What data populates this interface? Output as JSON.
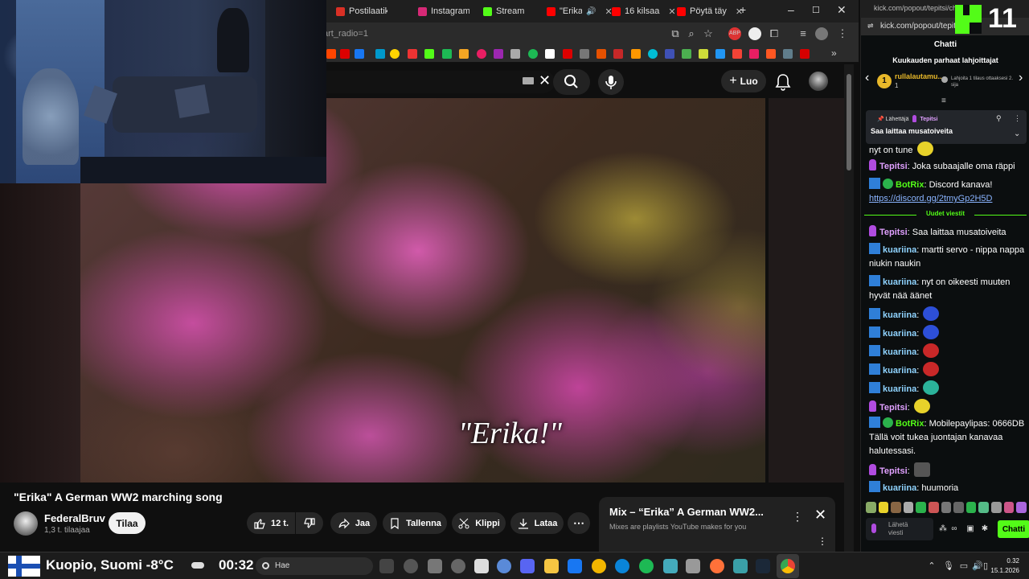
{
  "browser": {
    "tabs": [
      {
        "label": "Postilaatikko",
        "color": "#d93025"
      },
      {
        "label": "Instagram",
        "color": "#d62976"
      },
      {
        "label": "Stream",
        "color": "#53fc18"
      },
      {
        "label": "\"Erika\"",
        "color": "#ff0000"
      },
      {
        "label": "16 kilsaa",
        "color": "#ff0000"
      },
      {
        "label": "Pöytä täy",
        "color": "#ff0000"
      }
    ],
    "address_fragment": "art_radio=1"
  },
  "youtube": {
    "create_label": "Luo",
    "video_overlay_text": "\"Erika!\"",
    "video_title": "\"Erika\" A German WW2 marching song",
    "channel_name": "FederalBruv",
    "channel_subs": "1,3 t. tilaajaa",
    "subscribe_label": "Tilaa",
    "like_count": "12 t.",
    "share_label": "Jaa",
    "save_label": "Tallenna",
    "clip_label": "Klippi",
    "download_label": "Lataa",
    "mix_title": "Mix – “Erika” A German WW2...",
    "mix_subtitle": "Mixes are playlists YouTube makes for you"
  },
  "chat": {
    "url_full": "kick.com/popout/tepitsi/ch...",
    "url_short": "kick.com/popout/tepit",
    "viewer_count": "11",
    "title": "Chatti",
    "gifters_title": "Kuukauden parhaat lahjoittajat",
    "top_gifter_rank": "1",
    "top_gifter_name": "rullalautamu...",
    "top_gifter_count": "1",
    "gift_prompt": "Lahjoita 1 tilaus ottaaksesi 2. sija",
    "pinned_sender_label": "Lähettäjä",
    "pinned_sender": "Tepitsi",
    "pinned_text": "Saa laittaa musatoiveita",
    "new_messages_label": "Uudet viestit",
    "messages": [
      {
        "user": "",
        "text": "nyt on tune"
      },
      {
        "user": "Tepitsi",
        "text": "Joka subaajalle oma räppi"
      },
      {
        "user": "BotRix",
        "text": "Discord kanava!",
        "link": "https://discord.gg/2tmyGp2H5D"
      },
      {
        "user": "Tepitsi",
        "text": "Saa laittaa musatoiveita"
      },
      {
        "user": "kuariina",
        "text": "martti servo - nippa nappa niukin naukin"
      },
      {
        "user": "kuariina",
        "text": "nyt on oikeesti muuten hyvät nää äänet"
      },
      {
        "user": "kuariina",
        "text": ""
      },
      {
        "user": "kuariina",
        "text": ""
      },
      {
        "user": "kuariina",
        "text": ""
      },
      {
        "user": "kuariina",
        "text": ""
      },
      {
        "user": "kuariina",
        "text": ""
      },
      {
        "user": "Tepitsi",
        "text": ""
      },
      {
        "user": "BotRix",
        "text": "Mobilepaylipas: 0666DB Tällä voit tukea juontajan kanavaa halutessasi."
      },
      {
        "user": "Tepitsi",
        "text": ""
      },
      {
        "user": "kuariina",
        "text": "huumoria"
      }
    ],
    "input_placeholder": "Lähetä viesti",
    "send_label": "Chatti",
    "accent": "#53fc18"
  },
  "taskbar": {
    "weather": "Kuopio, Suomi -8°C",
    "clock_big": "00:32",
    "search_placeholder": "Hae",
    "time": "0.32",
    "date": "15.1.2026"
  }
}
